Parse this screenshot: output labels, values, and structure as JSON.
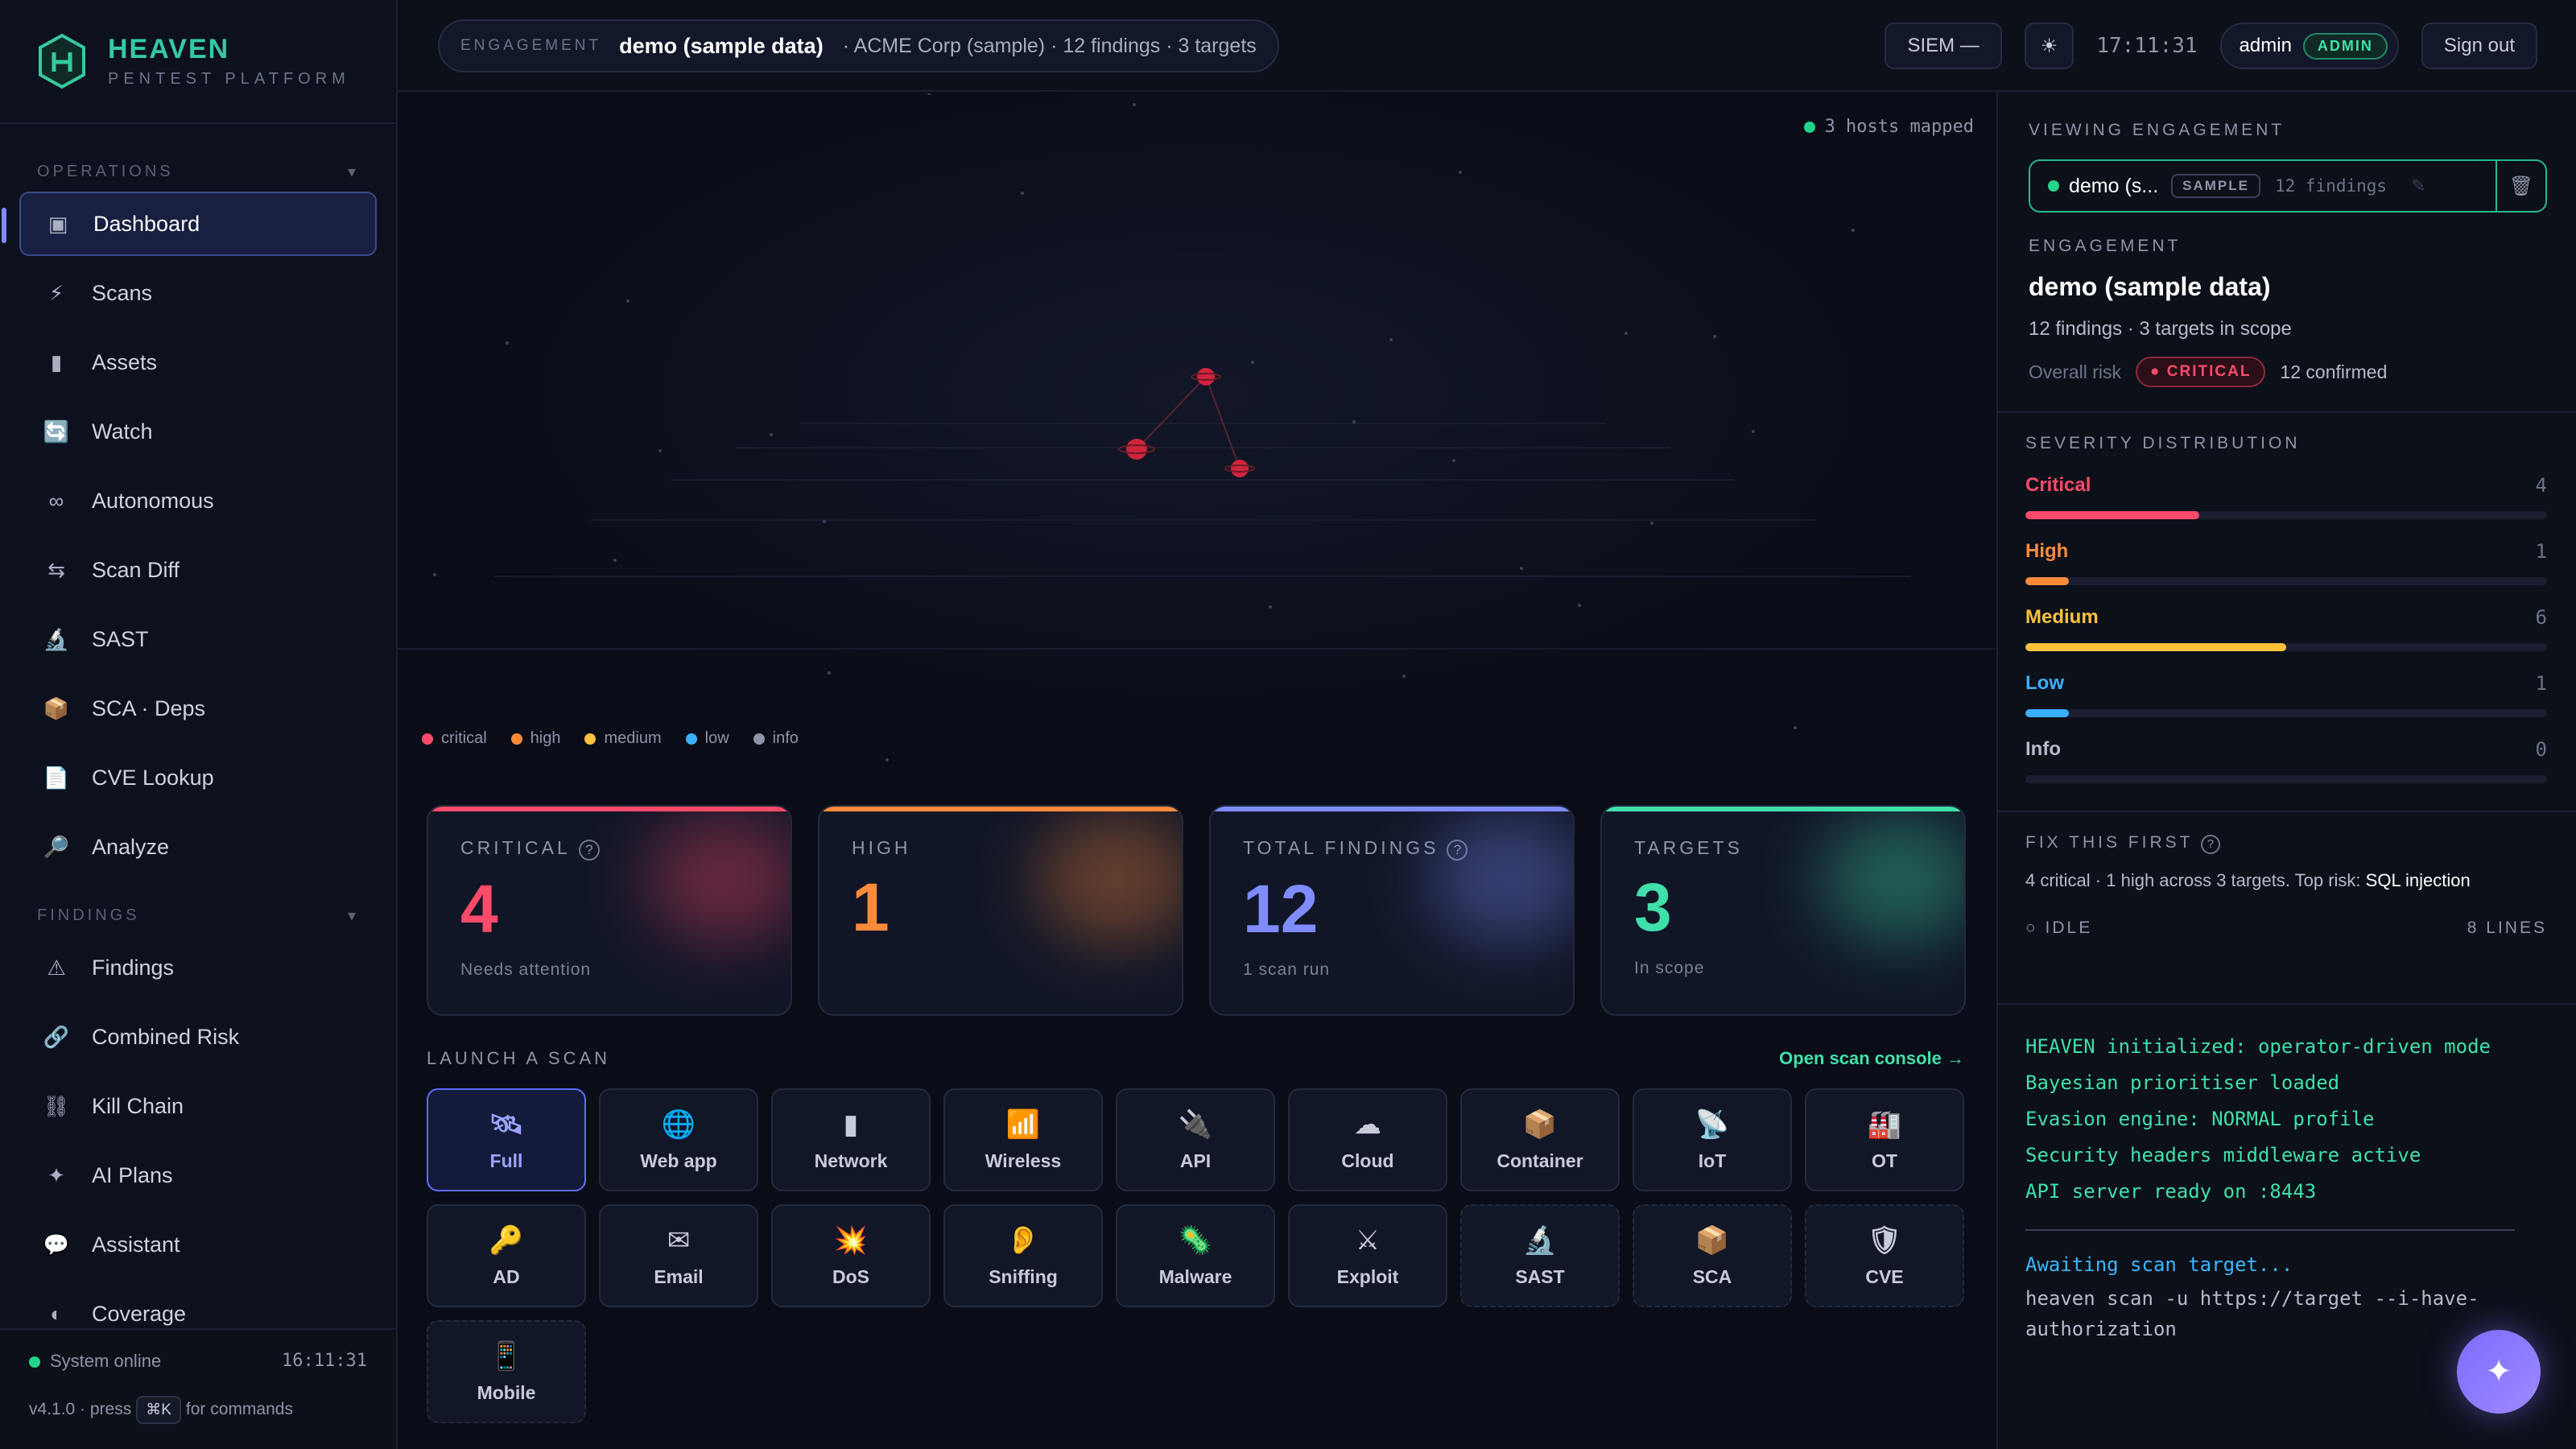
{
  "brand": {
    "name": "HEAVEN",
    "sub": "PENTEST PLATFORM"
  },
  "sidebar": {
    "operations_label": "OPERATIONS",
    "findings_label": "FINDINGS",
    "ops": [
      {
        "label": "Dashboard",
        "icon": "▣"
      },
      {
        "label": "Scans",
        "icon": "⚡"
      },
      {
        "label": "Assets",
        "icon": "▮"
      },
      {
        "label": "Watch",
        "icon": "🔄"
      },
      {
        "label": "Autonomous",
        "icon": "∞"
      },
      {
        "label": "Scan Diff",
        "icon": "⇆"
      },
      {
        "label": "SAST",
        "icon": "🔬"
      },
      {
        "label": "SCA · Deps",
        "icon": "📦"
      },
      {
        "label": "CVE Lookup",
        "icon": "📄"
      },
      {
        "label": "Analyze",
        "icon": "🔎"
      }
    ],
    "findings": [
      {
        "label": "Findings",
        "icon": "⚠"
      },
      {
        "label": "Combined Risk",
        "icon": "🔗"
      },
      {
        "label": "Kill Chain",
        "icon": "⛓"
      },
      {
        "label": "AI Plans",
        "icon": "✦"
      },
      {
        "label": "Assistant",
        "icon": "💬"
      },
      {
        "label": "Coverage",
        "icon": "◐"
      }
    ],
    "status": "System online",
    "time": "16:11:31",
    "version": "v4.1.0 · press",
    "shortcut": "⌘K",
    "shortcut_suffix": "for commands"
  },
  "topbar": {
    "engagement_label": "ENGAGEMENT",
    "engagement_value": "demo (sample data)",
    "engagement_meta": "· ACME Corp (sample)   · 12 findings · 3 targets",
    "siem": "SIEM —",
    "theme_icon": "☀",
    "clock": "17:11:31",
    "user": "admin",
    "role": "ADMIN",
    "signout": "Sign out"
  },
  "map": {
    "hosts_mapped": "3 hosts mapped",
    "legend": [
      {
        "label": "critical",
        "color": "#ff4a6a"
      },
      {
        "label": "high",
        "color": "#ff8a3a"
      },
      {
        "label": "medium",
        "color": "#ffc23a"
      },
      {
        "label": "low",
        "color": "#3ab0ff"
      },
      {
        "label": "info",
        "color": "#8e95a8"
      }
    ]
  },
  "cards": [
    {
      "label": "CRITICAL",
      "help": "?",
      "value": "4",
      "sub": "Needs attention",
      "color": "#ff4a6a"
    },
    {
      "label": "HIGH",
      "help": "",
      "value": "1",
      "sub": "",
      "color": "#ff8a3a"
    },
    {
      "label": "TOTAL FINDINGS",
      "help": "?",
      "value": "12",
      "sub": "1 scan run",
      "color": "#7f8cff"
    },
    {
      "label": "TARGETS",
      "help": "",
      "value": "3",
      "sub": "In scope",
      "color": "#3fe0aa"
    }
  ],
  "launch": {
    "title": "LAUNCH A SCAN",
    "console_link": "Open scan console →",
    "tiles": [
      {
        "label": "Full",
        "icon": "🛰"
      },
      {
        "label": "Web app",
        "icon": "🌐"
      },
      {
        "label": "Network",
        "icon": "▮"
      },
      {
        "label": "Wireless",
        "icon": "📶"
      },
      {
        "label": "API",
        "icon": "🔌"
      },
      {
        "label": "Cloud",
        "icon": "☁"
      },
      {
        "label": "Container",
        "icon": "📦"
      },
      {
        "label": "IoT",
        "icon": "📡"
      },
      {
        "label": "OT",
        "icon": "🏭"
      },
      {
        "label": "AD",
        "icon": "🔑"
      },
      {
        "label": "Email",
        "icon": "✉"
      },
      {
        "label": "DoS",
        "icon": "💥"
      },
      {
        "label": "Sniffing",
        "icon": "👂"
      },
      {
        "label": "Malware",
        "icon": "🦠"
      },
      {
        "label": "Exploit",
        "icon": "⚔"
      },
      {
        "label": "SAST",
        "icon": "🔬"
      },
      {
        "label": "SCA",
        "icon": "📦"
      },
      {
        "label": "CVE",
        "icon": "🛡"
      },
      {
        "label": "Mobile",
        "icon": "📱"
      }
    ]
  },
  "right": {
    "viewing_label": "VIEWING ENGAGEMENT",
    "viewing_name": "demo (s...",
    "viewing_tag": "SAMPLE",
    "viewing_count": "12 findings",
    "engagement_label": "ENGAGEMENT",
    "engagement_title": "demo (sample data)",
    "engagement_sub": "12 findings · 3 targets in scope",
    "risk_label": "Overall risk",
    "risk_value": "CRITICAL",
    "confirmed": "12 confirmed",
    "severity_label": "SEVERITY DISTRIBUTION",
    "severity": [
      {
        "name": "Critical",
        "count": "4",
        "fraction": 0.333,
        "color": "#ff4a6a"
      },
      {
        "name": "High",
        "count": "1",
        "fraction": 0.083,
        "color": "#ff8a3a"
      },
      {
        "name": "Medium",
        "count": "6",
        "fraction": 0.5,
        "color": "#ffc23a"
      },
      {
        "name": "Low",
        "count": "1",
        "fraction": 0.083,
        "color": "#3ab0ff"
      },
      {
        "name": "Info",
        "count": "0",
        "fraction": 0,
        "color": "#8e95a8"
      }
    ],
    "fix_label": "FIX THIS FIRST",
    "fix_text": "4 critical · 1 high across 3 targets. Top risk:",
    "fix_risk": "SQL injection",
    "idle": "IDLE",
    "lines": "8 LINES",
    "console": [
      "HEAVEN initialized: operator-driven mode",
      "Bayesian prioritiser loaded",
      "Evasion engine: NORMAL profile",
      "Security headers middleware active",
      "API server ready on :8443"
    ],
    "await": "Awaiting scan target...",
    "cmd": "heaven scan -u https://target --i-have-authorization"
  }
}
